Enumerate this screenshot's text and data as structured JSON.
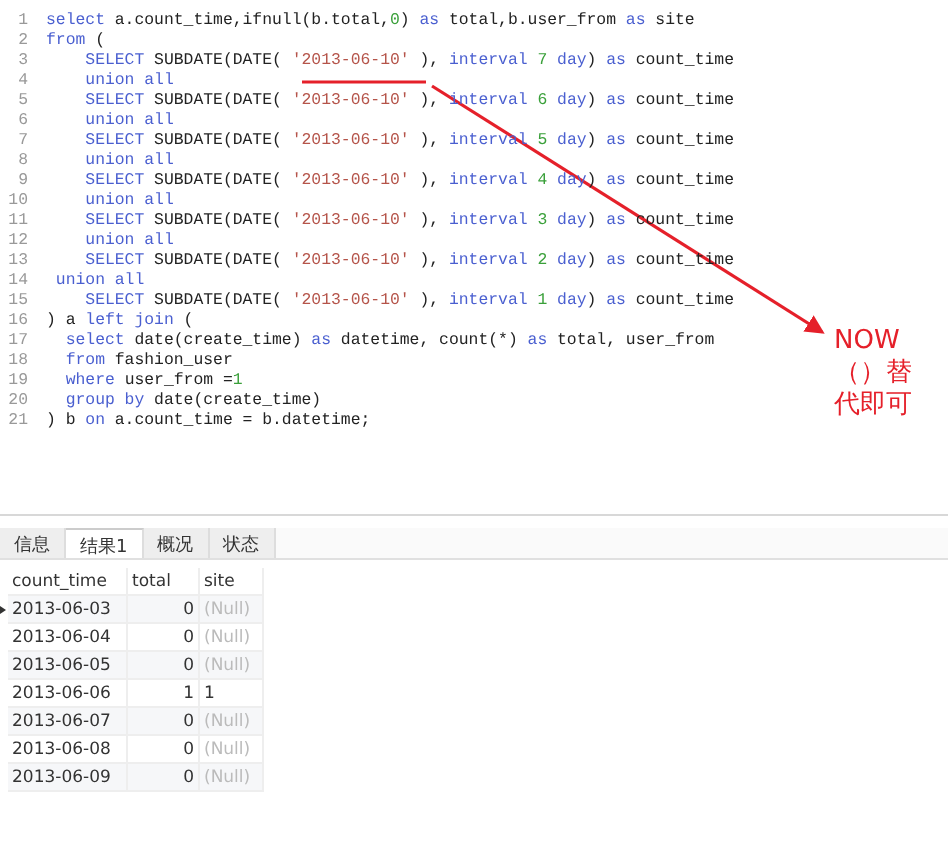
{
  "editor": {
    "lines": [
      {
        "number": "1",
        "tokens": [
          {
            "kind": "kw",
            "text": "select"
          },
          {
            "kind": "plain",
            "text": " a.count_time,ifnull(b.total,"
          },
          {
            "kind": "num",
            "text": "0"
          },
          {
            "kind": "plain",
            "text": ") "
          },
          {
            "kind": "kw",
            "text": "as"
          },
          {
            "kind": "plain",
            "text": " total,b.user_from "
          },
          {
            "kind": "kw",
            "text": "as"
          },
          {
            "kind": "plain",
            "text": " site"
          }
        ]
      },
      {
        "number": "2",
        "tokens": [
          {
            "kind": "kw",
            "text": "from"
          },
          {
            "kind": "plain",
            "text": " ("
          }
        ]
      },
      {
        "number": "3",
        "tokens": [
          {
            "kind": "kw",
            "text": "    SELECT"
          },
          {
            "kind": "plain",
            "text": " SUBDATE(DATE( "
          },
          {
            "kind": "str",
            "text": "'2013-06-10'"
          },
          {
            "kind": "plain",
            "text": " ), "
          },
          {
            "kind": "kw",
            "text": "interval "
          },
          {
            "kind": "num",
            "text": "7 "
          },
          {
            "kind": "kw",
            "text": "day"
          },
          {
            "kind": "plain",
            "text": ") "
          },
          {
            "kind": "kw",
            "text": "as"
          },
          {
            "kind": "plain",
            "text": " count_time"
          }
        ]
      },
      {
        "number": "4",
        "tokens": [
          {
            "kind": "kw",
            "text": "    union all"
          }
        ]
      },
      {
        "number": "5",
        "tokens": [
          {
            "kind": "kw",
            "text": "    SELECT"
          },
          {
            "kind": "plain",
            "text": " SUBDATE(DATE( "
          },
          {
            "kind": "str",
            "text": "'2013-06-10'"
          },
          {
            "kind": "plain",
            "text": " ), "
          },
          {
            "kind": "kw",
            "text": "interval "
          },
          {
            "kind": "num",
            "text": "6 "
          },
          {
            "kind": "kw",
            "text": "day"
          },
          {
            "kind": "plain",
            "text": ") "
          },
          {
            "kind": "kw",
            "text": "as"
          },
          {
            "kind": "plain",
            "text": " count_time"
          }
        ]
      },
      {
        "number": "6",
        "tokens": [
          {
            "kind": "kw",
            "text": "    union all"
          }
        ]
      },
      {
        "number": "7",
        "tokens": [
          {
            "kind": "kw",
            "text": "    SELECT"
          },
          {
            "kind": "plain",
            "text": " SUBDATE(DATE( "
          },
          {
            "kind": "str",
            "text": "'2013-06-10'"
          },
          {
            "kind": "plain",
            "text": " ), "
          },
          {
            "kind": "kw",
            "text": "interval "
          },
          {
            "kind": "num",
            "text": "5 "
          },
          {
            "kind": "kw",
            "text": "day"
          },
          {
            "kind": "plain",
            "text": ") "
          },
          {
            "kind": "kw",
            "text": "as"
          },
          {
            "kind": "plain",
            "text": " count_time"
          }
        ]
      },
      {
        "number": "8",
        "tokens": [
          {
            "kind": "kw",
            "text": "    union all"
          }
        ]
      },
      {
        "number": "9",
        "tokens": [
          {
            "kind": "kw",
            "text": "    SELECT"
          },
          {
            "kind": "plain",
            "text": " SUBDATE(DATE( "
          },
          {
            "kind": "str",
            "text": "'2013-06-10'"
          },
          {
            "kind": "plain",
            "text": " ), "
          },
          {
            "kind": "kw",
            "text": "interval "
          },
          {
            "kind": "num",
            "text": "4 "
          },
          {
            "kind": "kw",
            "text": "day"
          },
          {
            "kind": "plain",
            "text": ") "
          },
          {
            "kind": "kw",
            "text": "as"
          },
          {
            "kind": "plain",
            "text": " count_time"
          }
        ]
      },
      {
        "number": "10",
        "tokens": [
          {
            "kind": "kw",
            "text": "    union all"
          }
        ]
      },
      {
        "number": "11",
        "tokens": [
          {
            "kind": "kw",
            "text": "    SELECT"
          },
          {
            "kind": "plain",
            "text": " SUBDATE(DATE( "
          },
          {
            "kind": "str",
            "text": "'2013-06-10'"
          },
          {
            "kind": "plain",
            "text": " ), "
          },
          {
            "kind": "kw",
            "text": "interval "
          },
          {
            "kind": "num",
            "text": "3 "
          },
          {
            "kind": "kw",
            "text": "day"
          },
          {
            "kind": "plain",
            "text": ") "
          },
          {
            "kind": "kw",
            "text": "as"
          },
          {
            "kind": "plain",
            "text": " count_time"
          }
        ]
      },
      {
        "number": "12",
        "tokens": [
          {
            "kind": "kw",
            "text": "    union all"
          }
        ]
      },
      {
        "number": "13",
        "tokens": [
          {
            "kind": "kw",
            "text": "    SELECT"
          },
          {
            "kind": "plain",
            "text": " SUBDATE(DATE( "
          },
          {
            "kind": "str",
            "text": "'2013-06-10'"
          },
          {
            "kind": "plain",
            "text": " ), "
          },
          {
            "kind": "kw",
            "text": "interval "
          },
          {
            "kind": "num",
            "text": "2 "
          },
          {
            "kind": "kw",
            "text": "day"
          },
          {
            "kind": "plain",
            "text": ") "
          },
          {
            "kind": "kw",
            "text": "as"
          },
          {
            "kind": "plain",
            "text": " count_time"
          }
        ]
      },
      {
        "number": "14",
        "tokens": [
          {
            "kind": "kw",
            "text": " union all"
          }
        ]
      },
      {
        "number": "15",
        "tokens": [
          {
            "kind": "kw",
            "text": "    SELECT"
          },
          {
            "kind": "plain",
            "text": " SUBDATE(DATE( "
          },
          {
            "kind": "str",
            "text": "'2013-06-10'"
          },
          {
            "kind": "plain",
            "text": " ), "
          },
          {
            "kind": "kw",
            "text": "interval "
          },
          {
            "kind": "num",
            "text": "1 "
          },
          {
            "kind": "kw",
            "text": "day"
          },
          {
            "kind": "plain",
            "text": ") "
          },
          {
            "kind": "kw",
            "text": "as"
          },
          {
            "kind": "plain",
            "text": " count_time"
          }
        ]
      },
      {
        "number": "16",
        "tokens": [
          {
            "kind": "plain",
            "text": ") a "
          },
          {
            "kind": "kw",
            "text": "left join"
          },
          {
            "kind": "plain",
            "text": " ("
          }
        ]
      },
      {
        "number": "17",
        "tokens": [
          {
            "kind": "kw",
            "text": "  select"
          },
          {
            "kind": "plain",
            "text": " date(create_time) "
          },
          {
            "kind": "kw",
            "text": "as"
          },
          {
            "kind": "plain",
            "text": " datetime, count(*) "
          },
          {
            "kind": "kw",
            "text": "as"
          },
          {
            "kind": "plain",
            "text": " total, user_from"
          }
        ]
      },
      {
        "number": "18",
        "tokens": [
          {
            "kind": "kw",
            "text": "  from"
          },
          {
            "kind": "plain",
            "text": " fashion_user"
          }
        ]
      },
      {
        "number": "19",
        "tokens": [
          {
            "kind": "kw",
            "text": "  where"
          },
          {
            "kind": "plain",
            "text": " user_from ="
          },
          {
            "kind": "num",
            "text": "1"
          }
        ]
      },
      {
        "number": "20",
        "tokens": [
          {
            "kind": "kw",
            "text": "  group by"
          },
          {
            "kind": "plain",
            "text": " date(create_time)"
          }
        ]
      },
      {
        "number": "21",
        "tokens": [
          {
            "kind": "plain",
            "text": ") b "
          },
          {
            "kind": "kw",
            "text": "on"
          },
          {
            "kind": "plain",
            "text": " a.count_time = b.datetime;"
          }
        ]
      }
    ]
  },
  "annotation": {
    "lines": [
      "NOW",
      "（）替",
      "代即可"
    ]
  },
  "tabs": [
    {
      "label": "信息",
      "selected": false
    },
    {
      "label": "结果1",
      "selected": true
    },
    {
      "label": "概况",
      "selected": false
    },
    {
      "label": "状态",
      "selected": false
    }
  ],
  "table": {
    "columns": [
      "count_time",
      "total",
      "site"
    ],
    "rows": [
      {
        "current": true,
        "cells": [
          {
            "kind": "text",
            "text": "2013-06-03"
          },
          {
            "kind": "number",
            "text": "0"
          },
          {
            "kind": "null",
            "text": "(Null)"
          }
        ]
      },
      {
        "current": false,
        "cells": [
          {
            "kind": "text",
            "text": "2013-06-04"
          },
          {
            "kind": "number",
            "text": "0"
          },
          {
            "kind": "null",
            "text": "(Null)"
          }
        ]
      },
      {
        "current": false,
        "cells": [
          {
            "kind": "text",
            "text": "2013-06-05"
          },
          {
            "kind": "number",
            "text": "0"
          },
          {
            "kind": "null",
            "text": "(Null)"
          }
        ]
      },
      {
        "current": false,
        "cells": [
          {
            "kind": "text",
            "text": "2013-06-06"
          },
          {
            "kind": "number",
            "text": "1"
          },
          {
            "kind": "text",
            "text": "1"
          }
        ]
      },
      {
        "current": false,
        "cells": [
          {
            "kind": "text",
            "text": "2013-06-07"
          },
          {
            "kind": "number",
            "text": "0"
          },
          {
            "kind": "null",
            "text": "(Null)"
          }
        ]
      },
      {
        "current": false,
        "cells": [
          {
            "kind": "text",
            "text": "2013-06-08"
          },
          {
            "kind": "number",
            "text": "0"
          },
          {
            "kind": "null",
            "text": "(Null)"
          }
        ]
      },
      {
        "current": false,
        "cells": [
          {
            "kind": "text",
            "text": "2013-06-09"
          },
          {
            "kind": "number",
            "text": "0"
          },
          {
            "kind": "null",
            "text": "(Null)"
          }
        ]
      }
    ]
  }
}
